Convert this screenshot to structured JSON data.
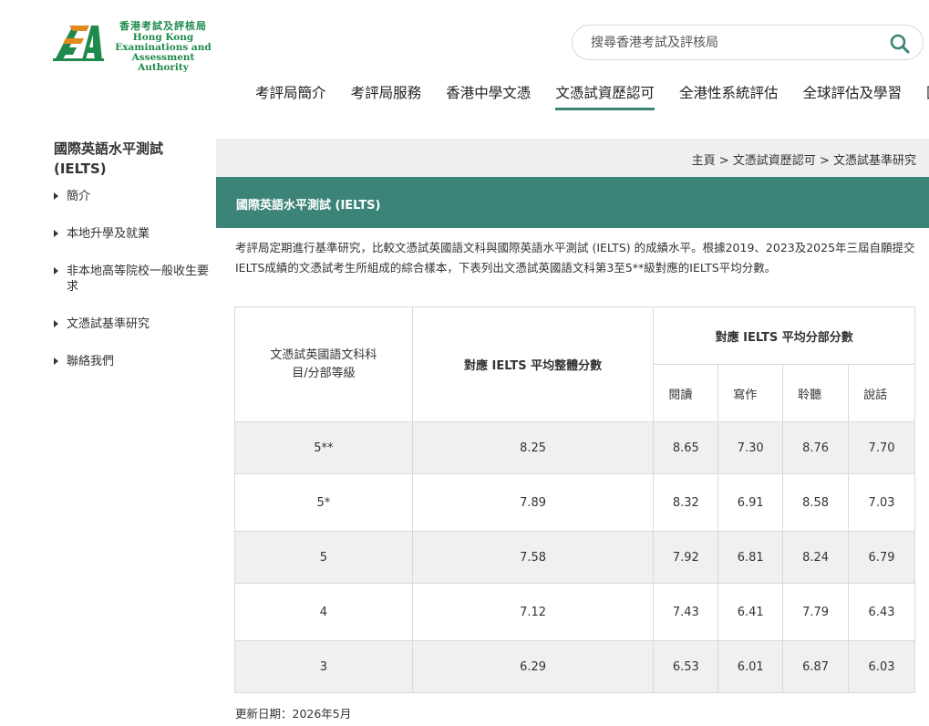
{
  "logo": {
    "zh": "香港考試及評核局",
    "en_line1": "Hong Kong",
    "en_line2": "Examinations and",
    "en_line3": "Assessment Authority"
  },
  "search": {
    "placeholder": "搜尋香港考試及評核局",
    "icon": "search-icon"
  },
  "nav": {
    "items": [
      {
        "label": "考評局簡介"
      },
      {
        "label": "考評局服務"
      },
      {
        "label": "香港中學文憑"
      },
      {
        "label": "文憑試資歷認可"
      },
      {
        "label": "全港性系統評估"
      },
      {
        "label": "全球評估及學習"
      },
      {
        "label": "國"
      }
    ]
  },
  "sidebar": {
    "title": "國際英語水平測試 (IELTS)",
    "items": [
      {
        "label": "簡介"
      },
      {
        "label": "本地升學及就業"
      },
      {
        "label": "非本地高等院校一般收生要求"
      },
      {
        "label": "文憑試基準研究"
      },
      {
        "label": "聯絡我們"
      }
    ]
  },
  "breadcrumb": {
    "home": "主頁",
    "sep": ">",
    "level2": "文憑試資歷認可",
    "level3": "文憑試基準研究"
  },
  "section": {
    "title": "國際英語水平測試 (IELTS)"
  },
  "intro": "考評局定期進行基準研究，比較文憑試英國語文科與國際英語水平測試 (IELTS) 的成績水平。根據2019、2023及2025年三屆自願提交IELTS成績的文憑試考生所組成的綜合樣本，下表列出文憑試英國語文科第3至5**級對應的IELTS平均分數。",
  "table": {
    "col_level": "文憑試英國語文科科目/分部等級",
    "col_overall": "對應 IELTS 平均整體分數",
    "col_subscores": "對應 IELTS 平均分部分數",
    "sub_headers": [
      "閱讀",
      "寫作",
      "聆聽",
      "說話"
    ],
    "rows": [
      {
        "level": "5**",
        "overall": "8.25",
        "reading": "8.65",
        "writing": "7.30",
        "listening": "8.76",
        "speaking": "7.70"
      },
      {
        "level": "5*",
        "overall": "7.89",
        "reading": "8.32",
        "writing": "6.91",
        "listening": "8.58",
        "speaking": "7.03"
      },
      {
        "level": "5",
        "overall": "7.58",
        "reading": "7.92",
        "writing": "6.81",
        "listening": "8.24",
        "speaking": "6.79"
      },
      {
        "level": "4",
        "overall": "7.12",
        "reading": "7.43",
        "writing": "6.41",
        "listening": "7.79",
        "speaking": "6.43"
      },
      {
        "level": "3",
        "overall": "6.29",
        "reading": "6.53",
        "writing": "6.01",
        "listening": "6.87",
        "speaking": "6.03"
      }
    ]
  },
  "updated": "更新日期：2026年5月",
  "colors": {
    "accent": "#3c8478",
    "logo_green": "#1f8a4c",
    "logo_orange": "#e38a1e"
  }
}
